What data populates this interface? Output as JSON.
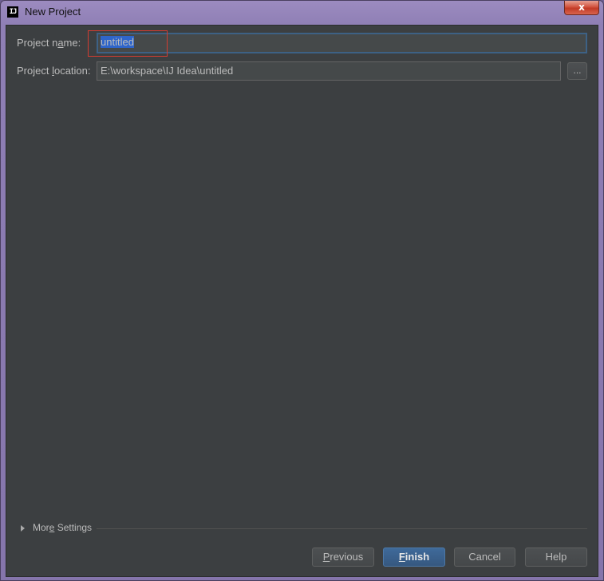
{
  "window": {
    "title": "New Project",
    "app_icon_text": "IJ",
    "close_glyph": "x"
  },
  "form": {
    "project_name": {
      "label_pre": "Project n",
      "label_mnemonic": "a",
      "label_post": "me:",
      "value": "untitled"
    },
    "project_location": {
      "label_pre": "Project ",
      "label_mnemonic": "l",
      "label_post": "ocation:",
      "value": "E:\\workspace\\IJ Idea\\untitled",
      "browse_label": "..."
    }
  },
  "more_settings": {
    "label_pre": "Mor",
    "label_mnemonic": "e",
    "label_post": " Settings",
    "expander_icon": "triangle-right-icon"
  },
  "buttons": {
    "previous": {
      "mnemonic": "P",
      "rest": "revious"
    },
    "finish": {
      "mnemonic": "F",
      "rest": "inish"
    },
    "cancel": {
      "label": "Cancel"
    },
    "help": {
      "label": "Help"
    }
  },
  "colors": {
    "background": "#3c3f41",
    "field_bg": "#45494a",
    "text": "#bbbbbb",
    "selection": "#2f65ca",
    "focus_border": "#3d6185",
    "default_button": "#365880",
    "annotation": "#d23c32"
  }
}
